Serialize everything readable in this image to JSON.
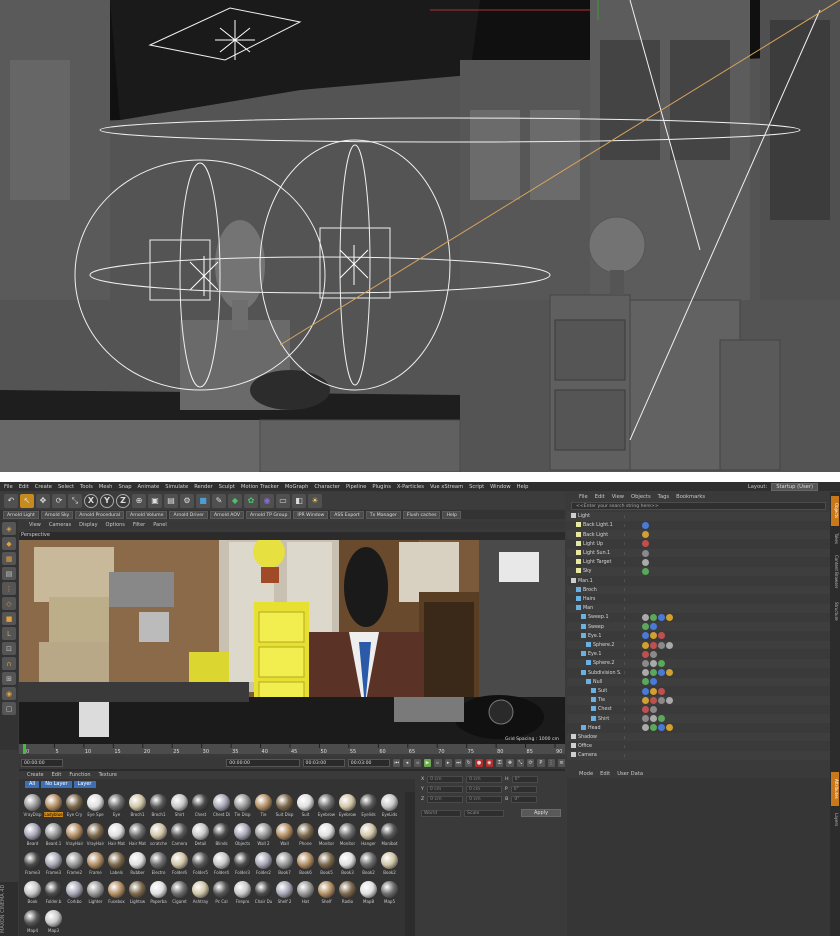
{
  "menubar": {
    "items": [
      "File",
      "Edit",
      "Create",
      "Select",
      "Tools",
      "Mesh",
      "Snap",
      "Animate",
      "Simulate",
      "Render",
      "Sculpt",
      "Motion Tracker",
      "MoGraph",
      "Character",
      "Pipeline",
      "Plugins",
      "X-Particles",
      "Vue xStream",
      "Script",
      "Window",
      "Help"
    ],
    "layout_label": "Layout:",
    "layout_value": "Startup (User)"
  },
  "toolbar": {
    "undo_icon": "↶",
    "tools": [
      "↖",
      "✥",
      "⟳",
      "⤡"
    ],
    "axes": [
      "X",
      "Y",
      "Z"
    ]
  },
  "arnold_bar": {
    "items": [
      "Arnold Light",
      "Arnold Sky",
      "Arnold Procedural",
      "Arnold Volume",
      "Arnold Driver",
      "Arnold AOV",
      "Arnold TP Group",
      "IPR Window",
      "ASS Export",
      "Tx Manager",
      "Flush caches",
      "Help"
    ]
  },
  "viewport": {
    "menu": [
      "View",
      "Cameras",
      "Display",
      "Options",
      "Filter",
      "Panel"
    ],
    "perspective_label": "Perspective",
    "grid_spacing": "Grid Spacing : 1000 cm"
  },
  "timeline": {
    "ticks": [
      "0",
      "5",
      "10",
      "15",
      "20",
      "25",
      "30",
      "35",
      "40",
      "45",
      "50",
      "55",
      "60",
      "65",
      "70",
      "75",
      "80",
      "85",
      "90"
    ],
    "end_label": "0 F"
  },
  "transport": {
    "start": "00:00:00",
    "current": "00:00:00",
    "end": "00:03:00",
    "end2": "00:03:00"
  },
  "material_manager": {
    "menu": [
      "Create",
      "Edit",
      "Function",
      "Texture"
    ],
    "filters": [
      "All",
      "No Layer",
      "Layer"
    ],
    "rows": [
      [
        "VrayDisp",
        "Ladyblue",
        "Eye Cry",
        "Eye Spe",
        "Eye",
        "Broch1",
        "Broch1",
        "Shirt",
        "Chest",
        "Chest Di",
        "Tie Disp",
        "Tie",
        "Suit Disp",
        "Suit",
        "Eyebrow",
        "Eyebrow",
        "Eyelids",
        "EyeLids"
      ],
      [
        "Beard",
        "Beard.1",
        "VrayHair",
        "VrayHair",
        "Hair Mat",
        "Hair Mat",
        "scratche",
        "Camera",
        "Detail",
        "Blinds",
        "Objects",
        "Wall 2",
        "Wall",
        "Phone",
        "Monitor",
        "Monitor",
        "Hanger",
        "Manibot"
      ],
      [
        "Frame3",
        "Frame3",
        "Frame2",
        "Frame",
        "Labels",
        "Rubber",
        "Electro",
        "Folder6",
        "Folder5",
        "Folder4",
        "Folder3",
        "Folder2",
        "Book7",
        "Book6",
        "Book5",
        "Book3",
        "Book2",
        "Book2"
      ],
      [
        "Book",
        "Folder.b",
        "Corkbo",
        "Lighter",
        "Fusebox",
        "Lightsw",
        "Paperba",
        "Cigaret",
        "Ashtray",
        "Pc Cal",
        "Firepro",
        "Chair Du",
        "Shelf 2",
        "Hat",
        "Shelf",
        "Radio",
        "Map8",
        "Map5"
      ],
      [
        "Map4",
        "Map3"
      ]
    ]
  },
  "attributes_panel": {
    "rows": [
      {
        "axis": "X",
        "a": "0 cm",
        "b": "0 cm",
        "c": "H",
        "d": "0°"
      },
      {
        "axis": "Y",
        "a": "0 cm",
        "b": "0 cm",
        "c": "P",
        "d": "0°"
      },
      {
        "axis": "Z",
        "a": "0 cm",
        "b": "0 cm",
        "c": "B",
        "d": "0°"
      }
    ],
    "world": "World",
    "scale": "Scale",
    "apply": "Apply"
  },
  "object_manager": {
    "menu": [
      "File",
      "Edit",
      "View",
      "Objects",
      "Tags",
      "Bookmarks"
    ],
    "search_placeholder": "<<Enter your search string here>>",
    "objects": [
      {
        "name": "Light",
        "indent": 0
      },
      {
        "name": "Back Light.1",
        "indent": 1
      },
      {
        "name": "Back Light",
        "indent": 1
      },
      {
        "name": "Light Up",
        "indent": 1
      },
      {
        "name": "Light Sun.1",
        "indent": 1
      },
      {
        "name": "Light Target",
        "indent": 1
      },
      {
        "name": "Sky",
        "indent": 1
      },
      {
        "name": "Man.1",
        "indent": 0
      },
      {
        "name": "Broch",
        "indent": 1
      },
      {
        "name": "Hairs",
        "indent": 1
      },
      {
        "name": "Man",
        "indent": 1
      },
      {
        "name": "Sweep.1",
        "indent": 2
      },
      {
        "name": "Sweep",
        "indent": 2
      },
      {
        "name": "Eye.1",
        "indent": 2
      },
      {
        "name": "Sphere.2",
        "indent": 3
      },
      {
        "name": "Eye.1",
        "indent": 2
      },
      {
        "name": "Sphere.2",
        "indent": 3
      },
      {
        "name": "Subdivision S.",
        "indent": 2
      },
      {
        "name": "Null",
        "indent": 3
      },
      {
        "name": "Suit",
        "indent": 4
      },
      {
        "name": "Tie",
        "indent": 4
      },
      {
        "name": "Chest",
        "indent": 4
      },
      {
        "name": "Shirt",
        "indent": 4
      },
      {
        "name": "Head",
        "indent": 2
      },
      {
        "name": "Shadow",
        "indent": 0
      },
      {
        "name": "Office",
        "indent": 0
      },
      {
        "name": "Camera",
        "indent": 0
      }
    ]
  },
  "attribute_manager": {
    "menu": [
      "Mode",
      "Edit",
      "User Data"
    ]
  },
  "right_tabs": [
    "Objects",
    "Takes",
    "Content Browser",
    "Structure",
    "Attributes",
    "Layers"
  ],
  "branding": "MAXON CINEMA 4D",
  "colors": {
    "accent": "#c98a1c",
    "selection": "#3d6fb6"
  }
}
